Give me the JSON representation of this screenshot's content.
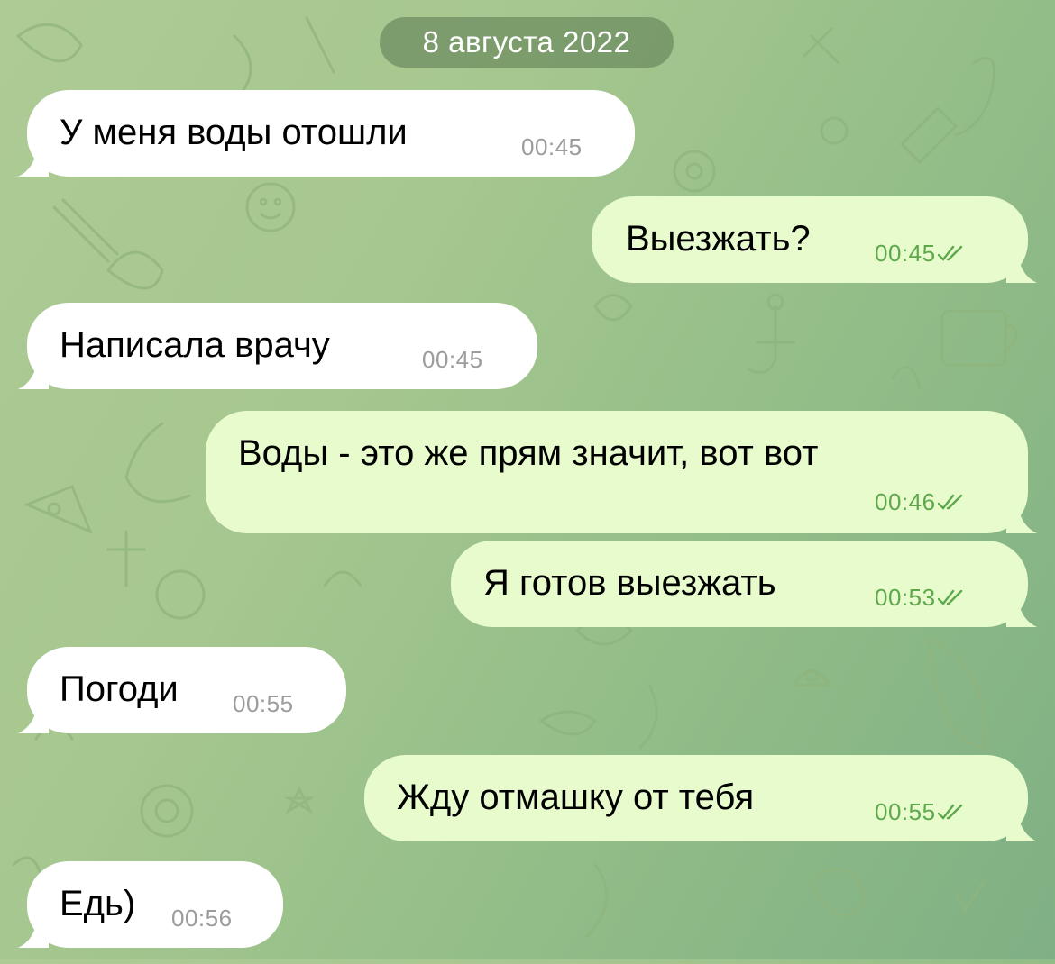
{
  "chat": {
    "date_label": "8 августа 2022",
    "messages": [
      {
        "direction": "incoming",
        "text": "У меня воды отошли",
        "time": "00:45"
      },
      {
        "direction": "outgoing",
        "text": "Выезжать?",
        "time": "00:45",
        "status": "read"
      },
      {
        "direction": "incoming",
        "text": "Написала врачу",
        "time": "00:45"
      },
      {
        "direction": "outgoing",
        "text": "Воды - это же прям значит, вот вот",
        "time": "00:46",
        "status": "read"
      },
      {
        "direction": "outgoing",
        "text": "Я готов выезжать",
        "time": "00:53",
        "status": "read"
      },
      {
        "direction": "incoming",
        "text": "Погоди",
        "time": "00:55"
      },
      {
        "direction": "outgoing",
        "text": "Жду отмашку от тебя",
        "time": "00:55",
        "status": "read"
      },
      {
        "direction": "incoming",
        "text": "Едь)",
        "time": "00:56"
      }
    ]
  },
  "colors": {
    "incoming_bubble": "#ffffff",
    "outgoing_bubble": "#e7fbcd",
    "outgoing_time": "#5ea84c",
    "incoming_time": "#9c9c9c",
    "wallpaper": "#a6c78f"
  },
  "icons": {
    "read_receipt": "double-check-icon",
    "wallpaper_pattern": "doodle-pattern-icon"
  }
}
